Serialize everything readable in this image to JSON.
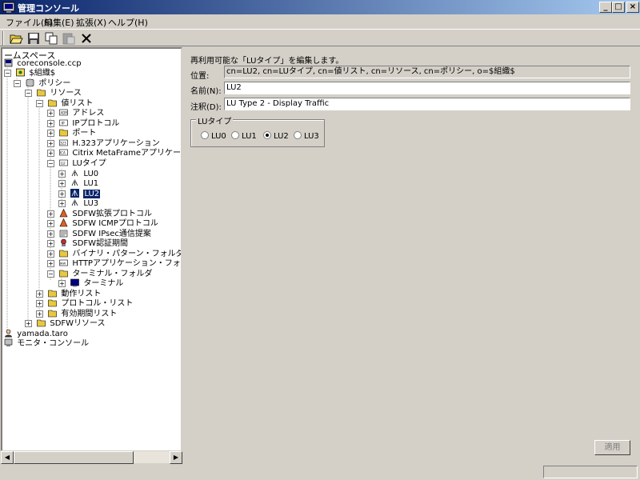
{
  "window": {
    "title": "管理コンソール"
  },
  "menu": [
    "ファイル(F)",
    "編集(E)",
    "拡張(X)",
    "ヘルプ(H)"
  ],
  "namespace": {
    "title": "ームスペース"
  },
  "tree": [
    {
      "label": "coreconsole.ccp"
    },
    {
      "label": "$組織$"
    },
    {
      "label": "ポリシー"
    },
    {
      "label": "リソース"
    },
    {
      "label": "値リスト"
    },
    {
      "label": "アドレス"
    },
    {
      "label": "IPプロトコル"
    },
    {
      "label": "ポート"
    },
    {
      "label": "H.323アプリケーション"
    },
    {
      "label": "Citrix MetaFrameアプリケーション"
    },
    {
      "label": "LUタイプ"
    },
    {
      "label": "LU0"
    },
    {
      "label": "LU1"
    },
    {
      "label": "LU2"
    },
    {
      "label": "LU3"
    },
    {
      "label": "SDFW拡張プロトコル"
    },
    {
      "label": "SDFW ICMPプロトコル"
    },
    {
      "label": "SDFW IPsec通信提案"
    },
    {
      "label": "SDFW認証期間"
    },
    {
      "label": "バイナリ・パターン・フォルダ"
    },
    {
      "label": "HTTPアプリケーション・フォルダ"
    },
    {
      "label": "ターミナル・フォルダ"
    },
    {
      "label": "ターミナル"
    },
    {
      "label": "動作リスト"
    },
    {
      "label": "プロトコル・リスト"
    },
    {
      "label": "有効期間リスト"
    },
    {
      "label": "SDFWリソース"
    },
    {
      "label": "yamada.taro"
    },
    {
      "label": "モニタ・コンソール"
    }
  ],
  "editor": {
    "description": "再利用可能な「LUタイプ」を編集します。",
    "location_label": "位置:",
    "location_value": "cn=LU2, cn=LUタイプ, cn=値リスト, cn=リソース, cn=ポリシー, o=$組織$",
    "name_label": "名前(N):",
    "name_value": "LU2",
    "comment_label": "注釈(D):",
    "comment_value": "LU Type 2 - Display Traffic",
    "group_label": "LUタイプ",
    "radios": [
      {
        "label": "LU0",
        "checked": false
      },
      {
        "label": "LU1",
        "checked": false
      },
      {
        "label": "LU2",
        "checked": true
      },
      {
        "label": "LU3",
        "checked": false
      }
    ],
    "apply_label": "適用"
  }
}
